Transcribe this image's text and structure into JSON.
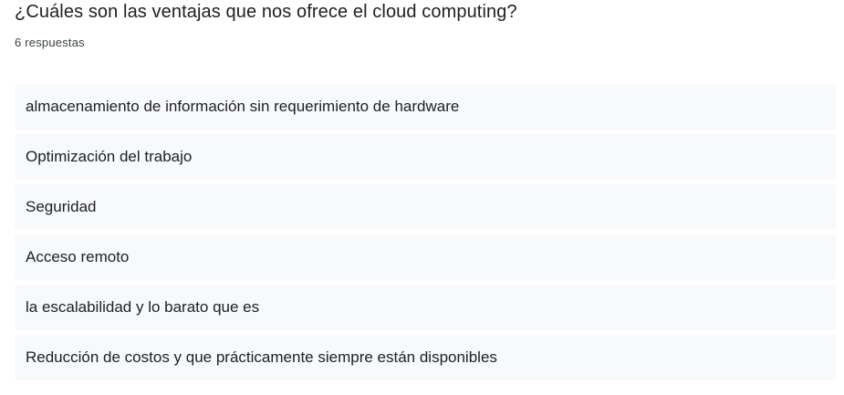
{
  "question": {
    "title": "¿Cuáles son las ventajas que nos ofrece el cloud computing?",
    "response_count": "6 respuestas"
  },
  "responses": [
    "almacenamiento de información sin requerimiento de hardware",
    "Optimización del trabajo",
    "Seguridad",
    "Acceso remoto",
    "la escalabilidad y lo barato que es",
    "Reducción de costos y que prácticamente siempre están disponibles"
  ]
}
